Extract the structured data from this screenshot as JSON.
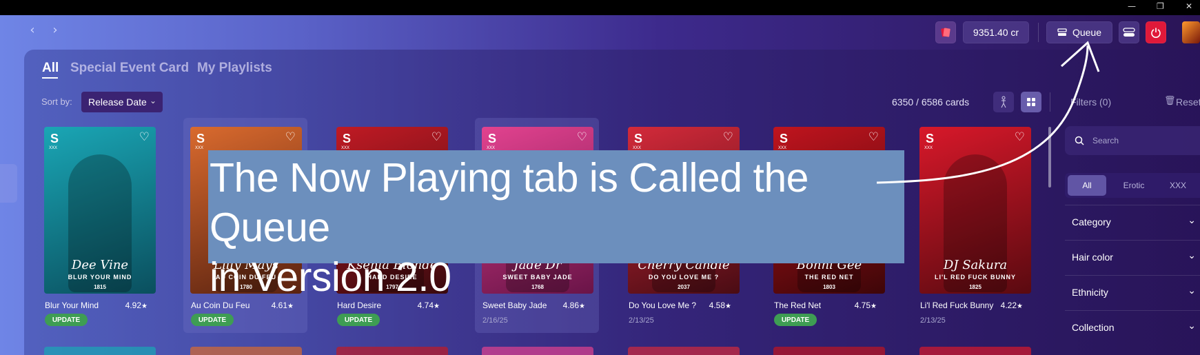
{
  "window": {
    "minimize": "—",
    "restore": "❐",
    "close": "✕"
  },
  "nav": {
    "back": "‹",
    "forward": "›"
  },
  "topbar": {
    "credits": "9351.40 cr",
    "queue_label": "Queue",
    "colors": {
      "power": "#e0193a",
      "button_bg": "#503c8c"
    }
  },
  "tabs": [
    {
      "label": "All",
      "active": true
    },
    {
      "label": "Special Event Card",
      "active": false
    },
    {
      "label": "My Playlists",
      "active": false
    }
  ],
  "toolbar": {
    "sort_label": "Sort by:",
    "sort_value": "Release Date",
    "count": "6350 / 6586 cards",
    "filters": "Filters (0)",
    "reset": "Reset"
  },
  "cards": [
    {
      "name": "Blur Your Mind",
      "rating": "4.92",
      "performer": "Dee Vine",
      "title": "BLUR YOUR MIND",
      "number": "1815",
      "badge": "UPDATE",
      "date": "",
      "colors": [
        "#1aa6b5",
        "#0a4f5e"
      ]
    },
    {
      "name": "Au Coin Du Feu",
      "rating": "4.61",
      "performer": "Lilly Mays",
      "title": "AU COIN DU FEU",
      "number": "1780",
      "badge": "UPDATE",
      "date": "",
      "colors": [
        "#d96a2e",
        "#5a2210"
      ]
    },
    {
      "name": "Hard Desire",
      "rating": "4.74",
      "performer": "Ksenia Blonde",
      "title": "HARD DESIRE",
      "number": "1797",
      "badge": "UPDATE",
      "date": "",
      "colors": [
        "#c01a24",
        "#3a0a0e"
      ]
    },
    {
      "name": "Sweet Baby Jade",
      "rating": "4.86",
      "performer": "Jade Dr",
      "title": "SWEET BABY JADE",
      "number": "1768",
      "badge": "",
      "date": "2/16/25",
      "colors": [
        "#e2428f",
        "#6a1448"
      ]
    },
    {
      "name": "Do You Love Me ?",
      "rating": "4.58",
      "performer": "Cherry Candle",
      "title": "DO YOU LOVE ME ?",
      "number": "2037",
      "badge": "",
      "date": "2/13/25",
      "colors": [
        "#d32a3a",
        "#4a0c14"
      ]
    },
    {
      "name": "The Red Net",
      "rating": "4.75",
      "performer": "Bonni Gee",
      "title": "THE RED NET",
      "number": "1803",
      "badge": "UPDATE",
      "date": "",
      "colors": [
        "#c0141e",
        "#3e0608"
      ]
    },
    {
      "name": "Li'l Red Fuck Bunny",
      "rating": "4.22",
      "performer": "DJ Sakura",
      "title": "LI'L RED FUCK BUNNY",
      "number": "1825",
      "badge": "",
      "date": "2/13/25",
      "colors": [
        "#d8182a",
        "#5a0a10"
      ]
    }
  ],
  "card_labels": {
    "s_badge": "S",
    "xxx": "XXX",
    "heart": "♡",
    "star": "★"
  },
  "sidebar": {
    "search_placeholder": "Search",
    "segments": [
      "All",
      "Erotic",
      "XXX"
    ],
    "filters": [
      "Category",
      "Hair color",
      "Ethnicity",
      "Collection"
    ]
  },
  "annotation": {
    "line1": "The Now Playing tab is Called the Queue",
    "line2": "in Version 2.0"
  }
}
